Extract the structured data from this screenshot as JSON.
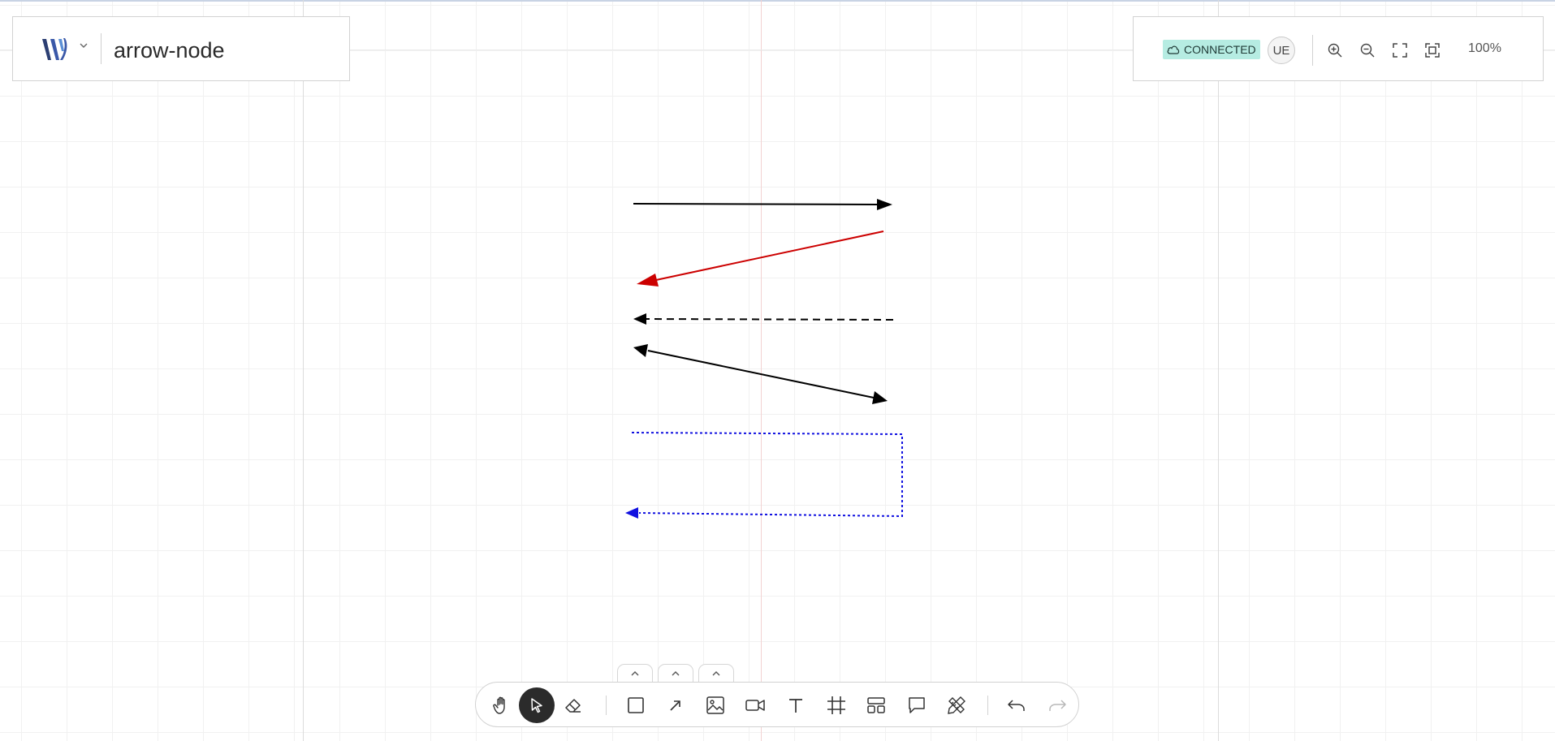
{
  "document": {
    "title": "arrow-node"
  },
  "status": {
    "connection": "CONNECTED",
    "user_initials": "UE",
    "zoom_level": "100%",
    "accent_color": "#b6ece2"
  },
  "toolbar": {
    "tools": [
      {
        "name": "hand-tool",
        "icon": "hand-icon",
        "active": false
      },
      {
        "name": "select-tool",
        "icon": "pointer-icon",
        "active": true
      },
      {
        "name": "eraser-tool",
        "icon": "eraser-icon",
        "active": false
      },
      {
        "name": "shape-tool",
        "icon": "square-icon",
        "active": false
      },
      {
        "name": "connector-tool",
        "icon": "arrow-icon",
        "active": false
      },
      {
        "name": "image-tool",
        "icon": "image-icon",
        "active": false
      },
      {
        "name": "embed-tool",
        "icon": "video-icon",
        "active": false
      },
      {
        "name": "text-tool",
        "icon": "text-icon",
        "active": false
      },
      {
        "name": "frame-tool",
        "icon": "frame-icon",
        "active": false
      },
      {
        "name": "template-tool",
        "icon": "template-icon",
        "active": false
      },
      {
        "name": "note-tool",
        "icon": "comment-icon",
        "active": false
      },
      {
        "name": "more-tools",
        "icon": "tools-icon",
        "active": false
      },
      {
        "name": "undo",
        "icon": "undo-icon",
        "active": false
      },
      {
        "name": "redo",
        "icon": "redo-icon",
        "active": false
      }
    ]
  },
  "arrows": [
    {
      "name": "arrow-solid-black",
      "color": "#000000",
      "style": "solid",
      "head": "end"
    },
    {
      "name": "arrow-solid-red",
      "color": "#cc0000",
      "style": "solid",
      "head": "end"
    },
    {
      "name": "arrow-dashed-black",
      "color": "#000000",
      "style": "dashed",
      "head": "end"
    },
    {
      "name": "arrow-double-black",
      "color": "#000000",
      "style": "solid",
      "head": "both"
    },
    {
      "name": "arrow-dotted-blue-elbow",
      "color": "#1010e0",
      "style": "dotted",
      "head": "end"
    }
  ]
}
